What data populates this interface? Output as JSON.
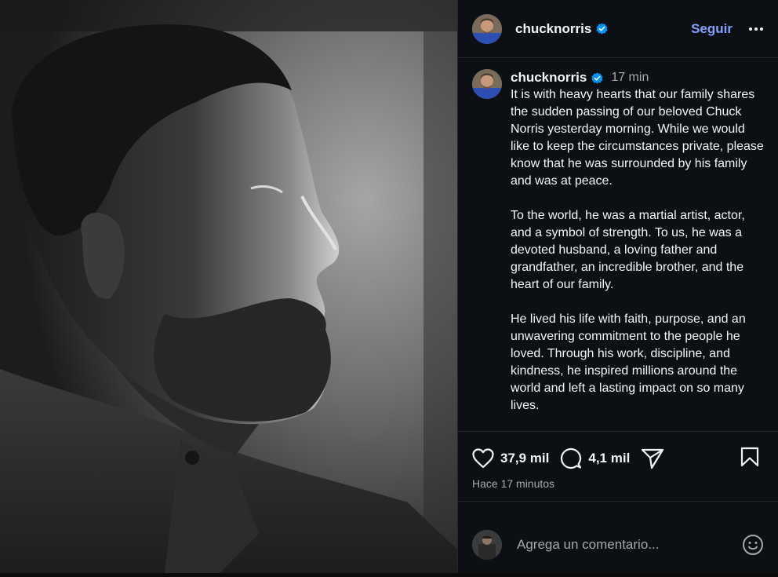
{
  "post": {
    "username": "chucknorris",
    "verified": true,
    "follow_label": "Seguir",
    "time_ago": "17 min",
    "caption_paragraphs": [
      "It is with heavy hearts that our family shares the sudden passing of our beloved Chuck Norris yesterday morning. While we would like to keep the circumstances private, please know that he was surrounded by his family and was at peace.",
      "To the world, he was a martial artist, actor, and a symbol of strength. To us, he was a devoted husband, a loving father and grandfather, an incredible brother, and the heart of our family.",
      "He lived his life with faith, purpose, and an unwavering commitment to the people he loved. Through his work, discipline, and kindness, he inspired millions around the world and left a lasting impact on so many lives."
    ],
    "likes": "37,9 mil",
    "comments": "4,1 mil",
    "posted_time": "Hace 17 minutos",
    "comment_placeholder": "Agrega un comentario..."
  },
  "icons": {
    "verified": "verified-badge-icon",
    "more": "more-options-icon",
    "like": "heart-icon",
    "comment": "comment-bubble-icon",
    "share": "send-icon",
    "save": "bookmark-icon",
    "emoji": "emoji-icon"
  },
  "colors": {
    "panel_bg": "#0c1014",
    "accent": "#85a1ff",
    "verified_blue": "#0095f6",
    "muted_text": "#a8a8a8"
  }
}
